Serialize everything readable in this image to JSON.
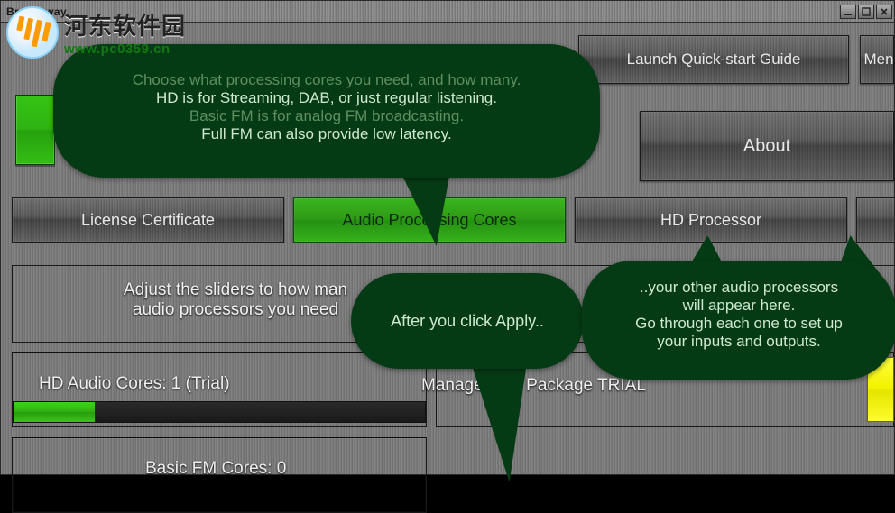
{
  "window": {
    "title": "Breakaway"
  },
  "top_buttons": {
    "quickstart": "Launch Quick-start Guide",
    "menu": "Men"
  },
  "about_label": "About",
  "tabs": {
    "license": "License Certificate",
    "cores": "Audio Processing Cores",
    "hdproc": "HD Processor"
  },
  "main": {
    "instruction_line1": "Adjust the sliders to how man",
    "instruction_line2": "audio processors you need",
    "hd_cores_label": "HD Audio Cores: 1 (Trial)",
    "basic_fm_label": "Basic FM Cores: 0",
    "mgmt_label": "Management Package TRIAL",
    "hd_slider_value_pct": 20
  },
  "bubbles": {
    "top": {
      "line1": "Choose what processing cores you need, and how many.",
      "line2": "HD is for Streaming, DAB, or just regular listening.",
      "line3": "Basic FM is for analog FM broadcasting.",
      "line4": "Full FM can also provide low latency."
    },
    "mid": "After you click Apply..",
    "right": {
      "line1": "..your other audio processors",
      "line2": "will appear here.",
      "line3": "Go through each one to set up",
      "line4": "your inputs and outputs."
    }
  },
  "watermark": {
    "line1": "河东软件园",
    "line2": "www.pc0359.cn"
  }
}
